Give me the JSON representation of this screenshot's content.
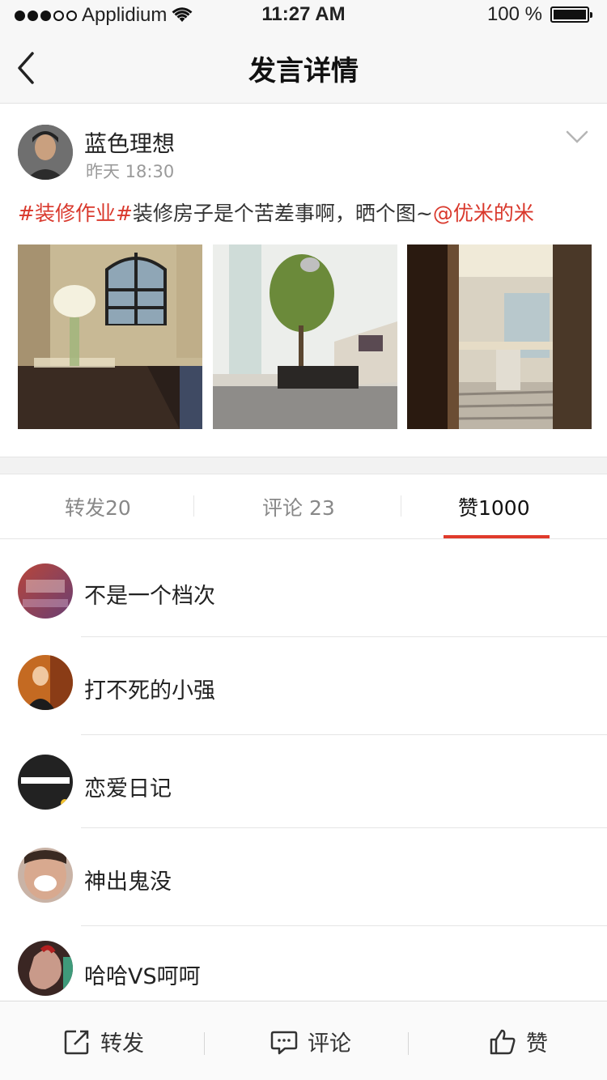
{
  "status_bar": {
    "carrier": "Applidium",
    "time": "11:27 AM",
    "battery": "100 %",
    "signal_icon": "signal-dots-icon",
    "wifi_icon": "wifi-icon",
    "battery_icon": "battery-icon"
  },
  "nav": {
    "title": "发言详情",
    "back_icon": "chevron-left-icon"
  },
  "post": {
    "author": "蓝色理想",
    "time": "昨天 18:30",
    "text_tag": "#装修作业#",
    "text_body": "装修房子是个苦差事啊，晒个图~",
    "text_mention": "@优米的米",
    "menu_icon": "chevron-down-icon",
    "images": [
      "dining-room-photo",
      "living-room-photo",
      "doorway-photo"
    ]
  },
  "tabs": [
    {
      "label": "转发20",
      "active": false
    },
    {
      "label": "评论 23",
      "active": false
    },
    {
      "label": "赞1000",
      "active": true
    }
  ],
  "likes": [
    {
      "name": "不是一个档次"
    },
    {
      "name": "打不死的小强"
    },
    {
      "name": "恋爱日记"
    },
    {
      "name": "神出鬼没"
    },
    {
      "name": "哈哈VS呵呵"
    }
  ],
  "toolbar": {
    "repost_label": "转发",
    "comment_label": "评论",
    "like_label": "赞"
  },
  "colors": {
    "accent": "#e03a2b",
    "link_red": "#d9382c"
  }
}
